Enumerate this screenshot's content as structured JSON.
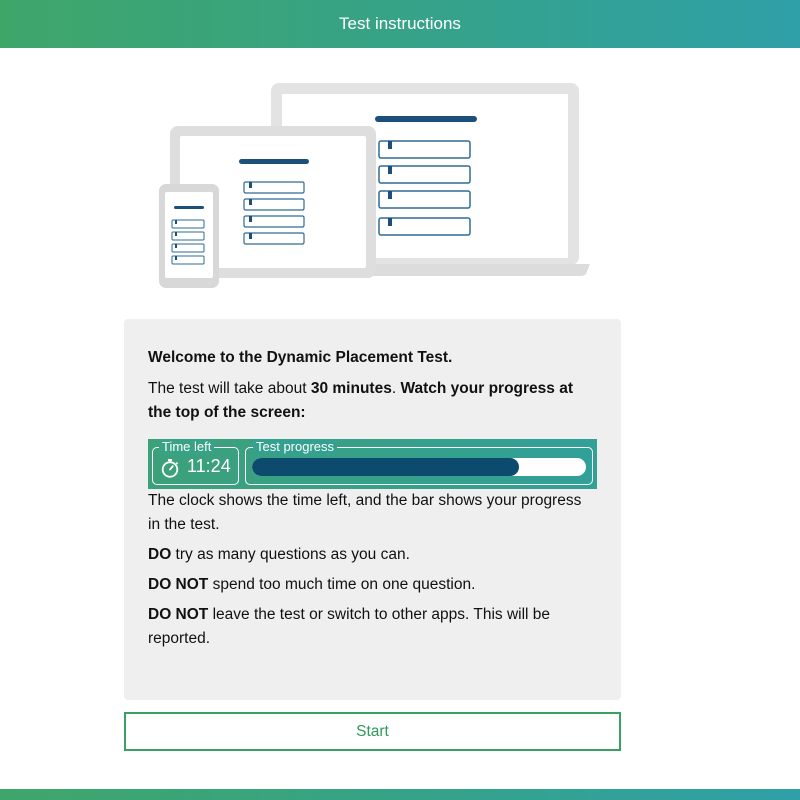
{
  "header": {
    "title": "Test instructions"
  },
  "illustration": {
    "icon": "devices-illustration"
  },
  "card": {
    "welcome": "Welcome to the Dynamic Placement Test.",
    "intro_prefix": "The test will take about ",
    "intro_duration": "30 minutes",
    "intro_dot": ". ",
    "intro_bold": "Watch your progress at the top of the screen:",
    "banner": {
      "time_label": "Time left",
      "time_value": "11:24",
      "progress_label": "Test progress",
      "progress_fraction": 0.8,
      "clock_icon": "stopwatch-icon"
    },
    "clock_text": "The clock shows the time left, and the bar shows your progress in the test.",
    "do_label": "DO",
    "do_text": " try as many questions as you can.",
    "donot1_label": "DO NOT",
    "donot1_text": " spend too much time on one question.",
    "donot2_label": "DO NOT",
    "donot2_text": " leave the test or switch to other apps. This will be reported."
  },
  "start_button": {
    "label": "Start"
  },
  "colors": {
    "brand_green": "#3fa66a",
    "brand_teal": "#2fa0a8",
    "progress_fill": "#0c4a6e",
    "card_bg": "#efefef"
  }
}
